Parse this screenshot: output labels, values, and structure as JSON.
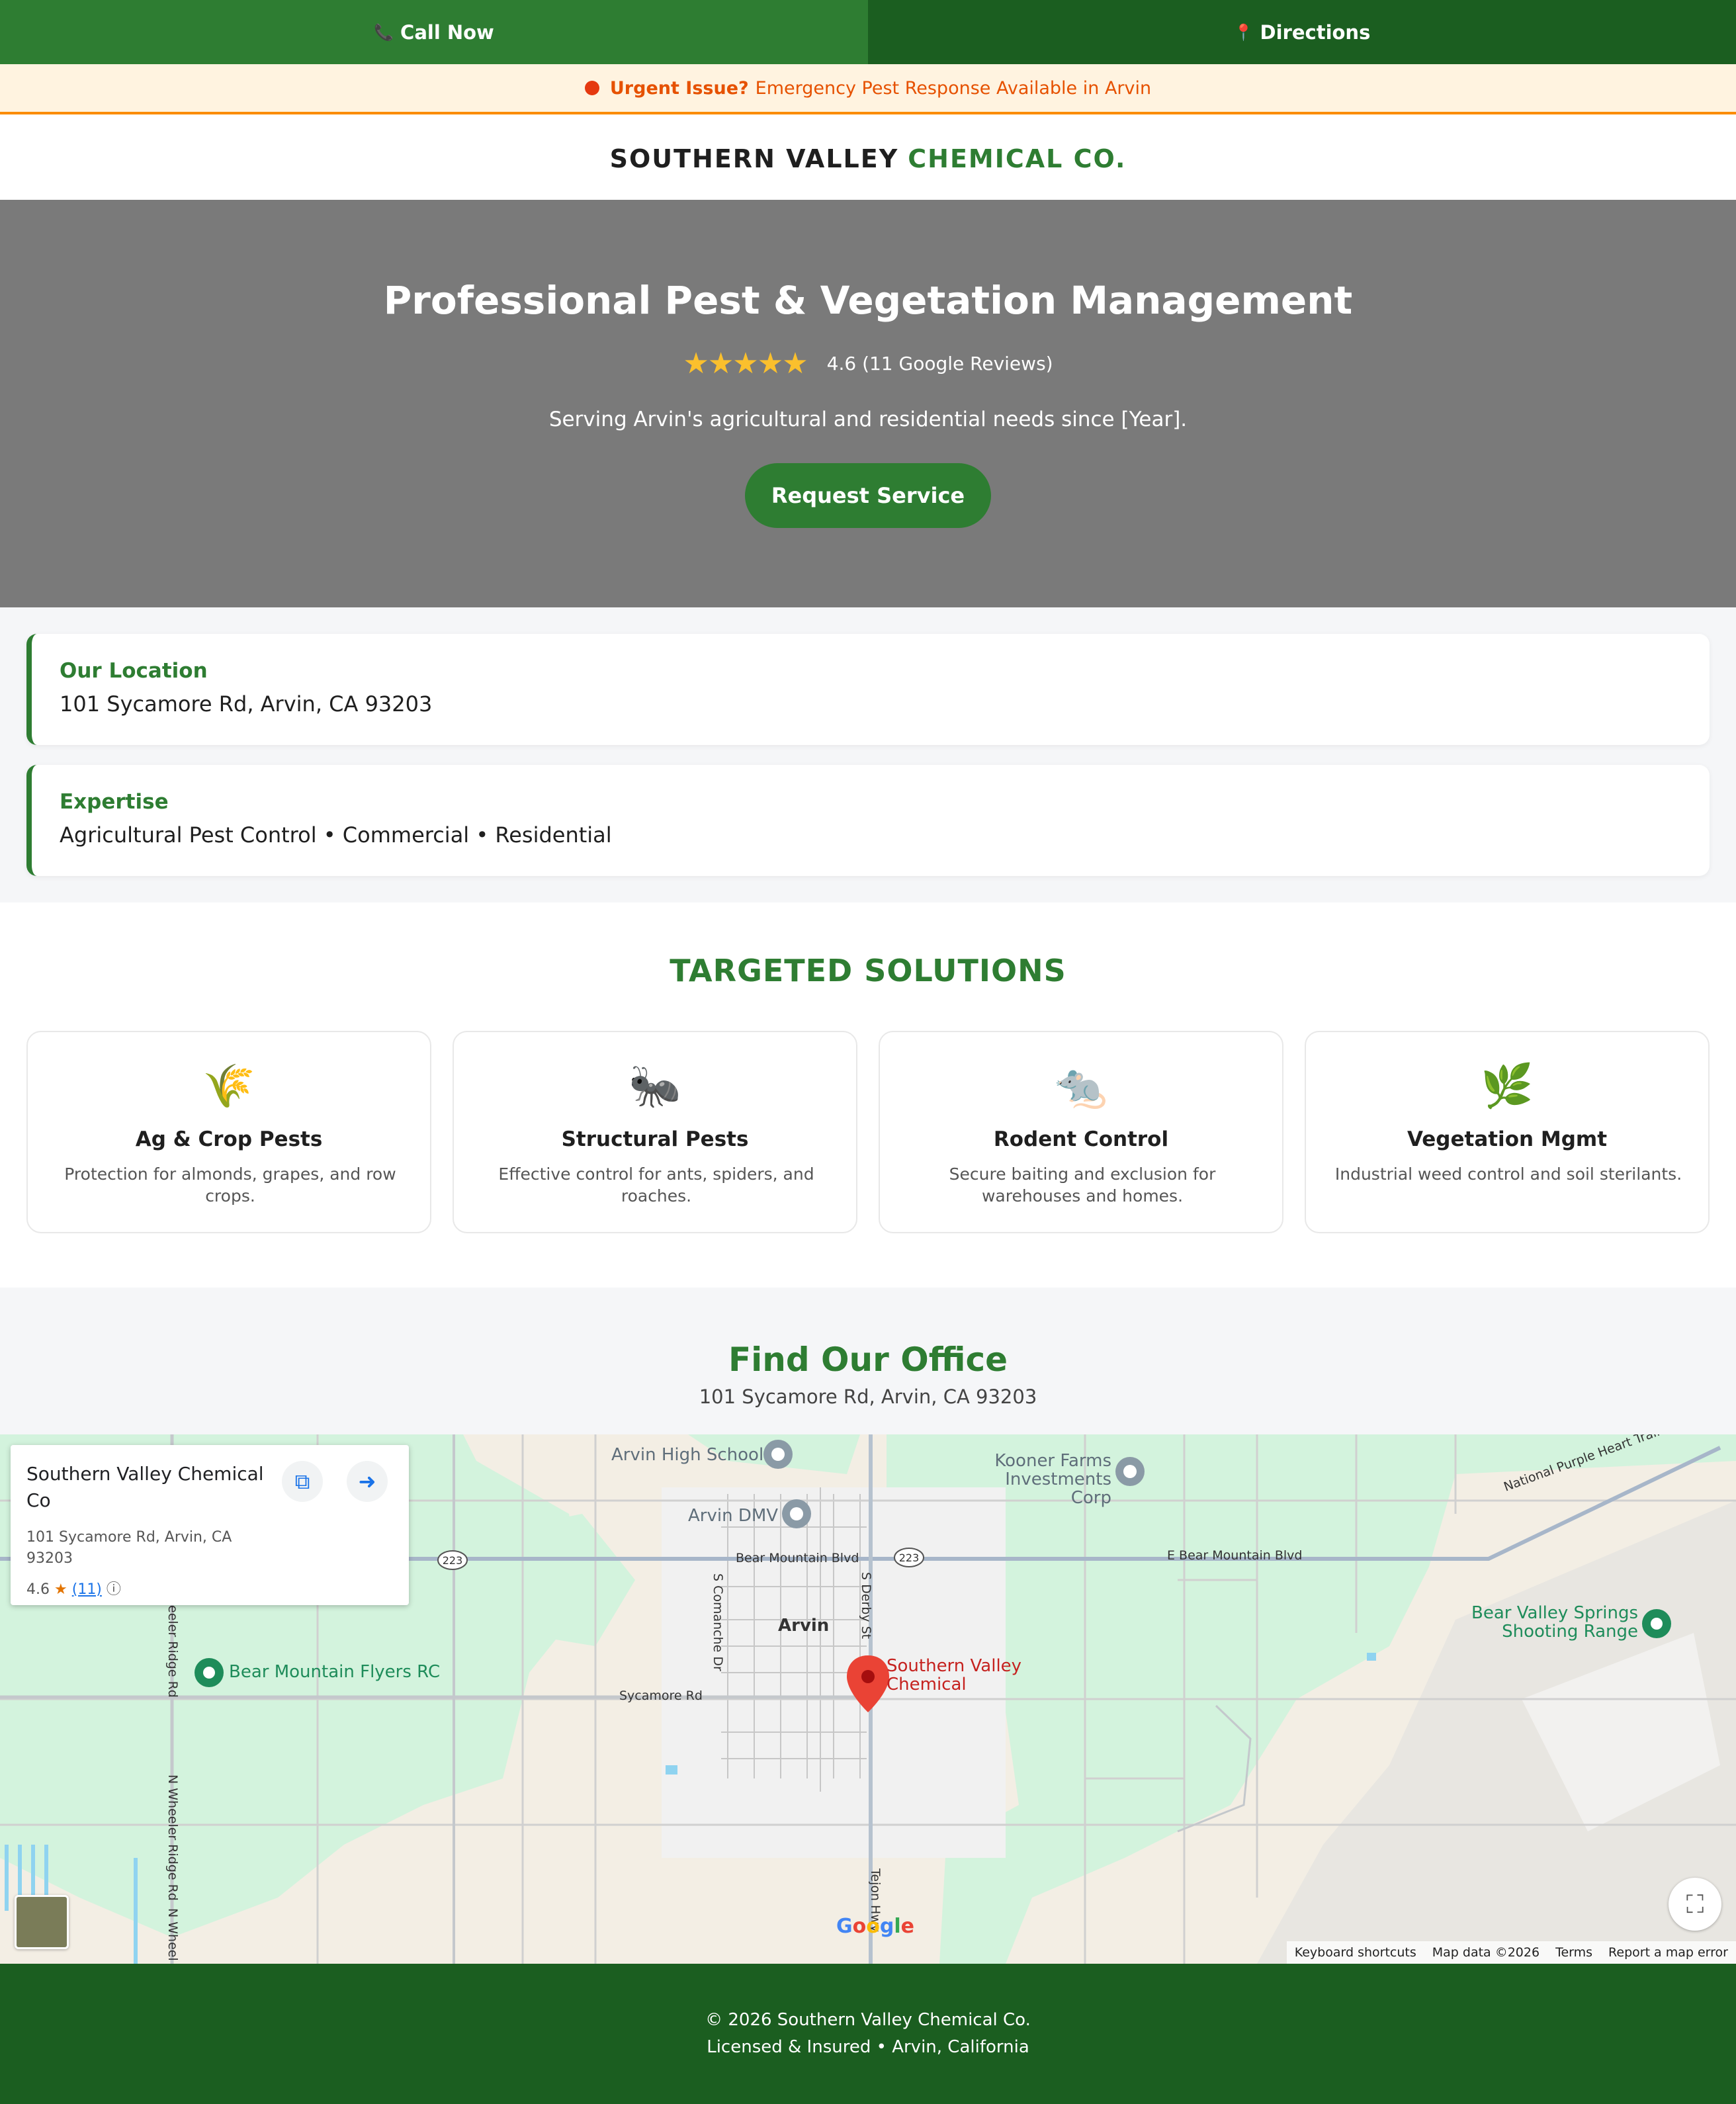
{
  "topbar": {
    "call_label": "Call Now",
    "call_icon": "phone-icon",
    "directions_label": "Directions",
    "directions_icon": "pin-icon"
  },
  "urgent": {
    "bold": "Urgent Issue?",
    "text": "Emergency Pest Response Available in Arvin"
  },
  "brand": {
    "dark": "SOUTHERN VALLEY",
    "green": "CHEMICAL CO."
  },
  "hero": {
    "title": "Professional Pest & Vegetation Management",
    "stars": "★★★★★",
    "rating_text": "4.6 (11 Google Reviews)",
    "subtitle": "Serving Arvin's agricultural and residential needs since [Year].",
    "button": "Request Service"
  },
  "info_cards": [
    {
      "label": "Our Location",
      "value": "101 Sycamore Rd, Arvin, CA 93203"
    },
    {
      "label": "Expertise",
      "value": "Agricultural Pest Control • Commercial • Residential"
    }
  ],
  "solutions": {
    "title": "TARGETED SOLUTIONS",
    "items": [
      {
        "icon": "🌾",
        "title": "Ag & Crop Pests",
        "desc": "Protection for almonds, grapes, and row crops."
      },
      {
        "icon": "🐜",
        "title": "Structural Pests",
        "desc": "Effective control for ants, spiders, and roaches."
      },
      {
        "icon": "🐀",
        "title": "Rodent Control",
        "desc": "Secure baiting and exclusion for warehouses and homes."
      },
      {
        "icon": "🌿",
        "title": "Vegetation Mgmt",
        "desc": "Industrial weed control and soil sterilants."
      }
    ]
  },
  "office": {
    "title": "Find Our Office",
    "address": "101 Sycamore Rd, Arvin, CA 93203"
  },
  "map": {
    "infocard": {
      "name": "Southern Valley Chemical Co",
      "address": "101 Sycamore Rd, Arvin, CA 93203",
      "rating": "4.6",
      "star": "★",
      "count": "(11)",
      "info": "ⓘ"
    },
    "labels": {
      "arvin_high": "Arvin High School",
      "kooner": "Kooner Farms Investments Corp",
      "arvin_dmv": "Arvin DMV",
      "bear_mtn_blvd": "Bear Mountain Blvd",
      "e_bear_mtn_blvd": "E Bear Mountain Blvd",
      "hwy": "223",
      "national_trail": "National Purple Heart Trail",
      "s_comanche": "S Comanche Dr",
      "s_derby": "S Derby St",
      "town": "Arvin",
      "bear_valley": "Bear Valley Springs Shooting Range",
      "bear_mtn_flyers": "Bear Mountain Flyers RC",
      "sycamore_rd": "Sycamore Rd",
      "pin": "Southern Valley Chemical",
      "wheeler_top": "heeler Ridge Rd",
      "wheeler_bottom": "N Wheeler Ridge Rd",
      "wheeler_far": "N Wheel",
      "tejon": "Tejon Hwy"
    },
    "footer": {
      "shortcuts": "Keyboard shortcuts",
      "data": "Map data ©2026",
      "terms": "Terms",
      "report": "Report a map error"
    },
    "google": "Google"
  },
  "footer": {
    "line1": "© 2026 Southern Valley Chemical Co.",
    "line2": "Licensed & Insured • Arvin, California"
  },
  "colors": {
    "primary_green": "#2e7d32",
    "dark_green": "#1b5e20",
    "urgent_orange": "#e65100",
    "star_gold": "#fbc02d"
  }
}
